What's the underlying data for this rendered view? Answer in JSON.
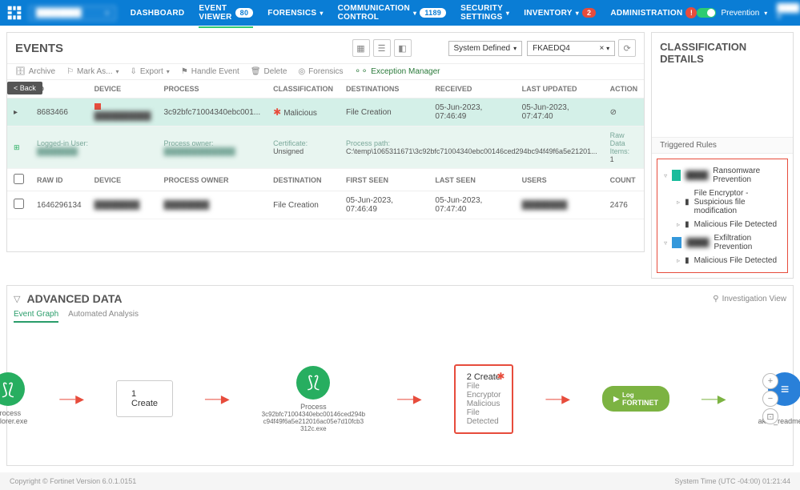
{
  "nav": {
    "dashboard": "DASHBOARD",
    "event_viewer": "EVENT VIEWER",
    "event_viewer_badge": "80",
    "forensics": "FORENSICS",
    "comm_control": "COMMUNICATION CONTROL",
    "comm_badge": "1189",
    "security": "SECURITY SETTINGS",
    "inventory": "INVENTORY",
    "inventory_badge": "2",
    "administration": "ADMINISTRATION",
    "prevention": "Prevention"
  },
  "events": {
    "title": "EVENTS",
    "scope_label": "System Defined",
    "scope_value": "FKAEDQ4",
    "toolbar": {
      "archive": "Archive",
      "mark": "Mark As...",
      "export": "Export",
      "handle": "Handle Event",
      "delete": "Delete",
      "forensics": "Forensics",
      "exception": "Exception Manager"
    },
    "back": "< Back",
    "cols": {
      "id": "ID",
      "device": "DEVICE",
      "process": "PROCESS",
      "classification": "CLASSIFICATION",
      "destinations": "DESTINATIONS",
      "received": "RECEIVED",
      "last_updated": "LAST UPDATED",
      "action": "ACTION"
    },
    "row1": {
      "id": "8683466",
      "process": "3c92bfc71004340ebc001...",
      "classification": "Malicious",
      "destinations": "File Creation",
      "received": "05-Jun-2023, 07:46:49",
      "last_updated": "05-Jun-2023, 07:47:40"
    },
    "detail": {
      "logged_user": "Logged-in User:",
      "process_owner": "Process owner:",
      "certificate": "Certificate:",
      "certificate_val": "Unsigned",
      "process_path": "Process path:",
      "process_path_val": "C:\\temp\\1065311671\\3c92bfc71004340ebc00146ced294bc94f49f6a5e21201...",
      "raw_items": "Raw Data Items:",
      "raw_items_val": "1"
    },
    "cols2": {
      "raw_id": "RAW ID",
      "device": "DEVICE",
      "process_owner": "PROCESS OWNER",
      "destination": "DESTINATION",
      "first_seen": "FIRST SEEN",
      "last_seen": "LAST SEEN",
      "users": "USERS",
      "count": "COUNT"
    },
    "row2": {
      "raw_id": "1646296134",
      "destination": "File Creation",
      "first_seen": "05-Jun-2023, 07:46:49",
      "last_seen": "05-Jun-2023, 07:47:40",
      "count": "2476"
    }
  },
  "classification": {
    "title": "CLASSIFICATION DETAILS",
    "triggered": "Triggered Rules",
    "group1": "Ransomware Prevention",
    "g1_r1": "File Encryptor - Suspicious file modification",
    "g1_r2": "Malicious File Detected",
    "group2": "Exfiltration Prevention",
    "g2_r1": "Malicious File Detected"
  },
  "advanced": {
    "title": "ADVANCED DATA",
    "tab_graph": "Event Graph",
    "tab_auto": "Automated Analysis",
    "investigation": "Investigation View",
    "n1_label": "Process",
    "n1_sub": "explorer.exe",
    "edge1": "1 Create",
    "n2_label": "Process",
    "n2_sub": "3c92bfc71004340ebc00146ced294b\nc94f49f6a5e212016ac05e7d10fcb3\n312c.exe",
    "edge2_title": "2 Create",
    "edge2_l1": "File Encryptor",
    "edge2_l2": "Malicious File Detected",
    "log": "Log",
    "fortinet": "FORTINET",
    "n3_sub": "akira_readme.txt"
  },
  "footer": {
    "copyright": "Copyright © Fortinet Version 6.0.1.0151",
    "time": "System Time (UTC -04:00)  01:21:44"
  }
}
